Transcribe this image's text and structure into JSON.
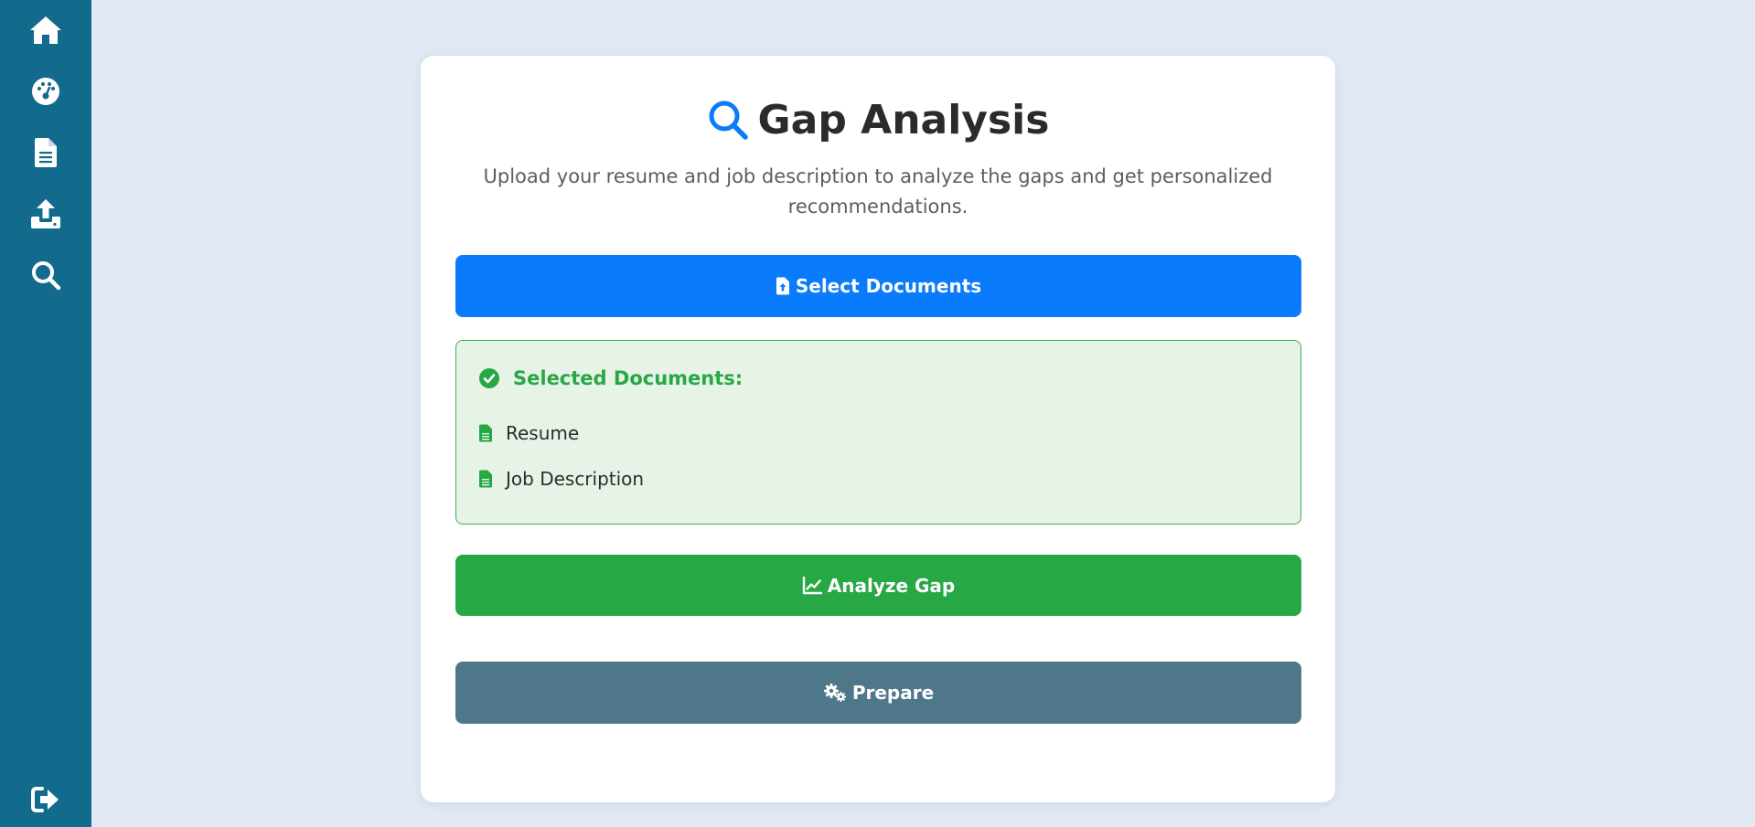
{
  "sidebar": {
    "items": [
      {
        "name": "home",
        "icon": "home-icon"
      },
      {
        "name": "dashboard",
        "icon": "gauge-icon"
      },
      {
        "name": "documents",
        "icon": "file-icon"
      },
      {
        "name": "upload",
        "icon": "upload-icon"
      },
      {
        "name": "search",
        "icon": "search-icon"
      }
    ],
    "logout_icon": "sign-out-icon"
  },
  "page": {
    "title": "Gap Analysis",
    "title_icon": "search-icon",
    "subtitle": "Upload your resume and job description to analyze the gaps and get personalized recommendations."
  },
  "buttons": {
    "select_documents": "Select Documents",
    "analyze_gap": "Analyze Gap",
    "prepare": "Prepare"
  },
  "selected_documents": {
    "title": "Selected Documents:",
    "items": [
      "Resume",
      "Job Description"
    ]
  },
  "colors": {
    "sidebar": "#126a8c",
    "background": "#dfe8f3",
    "primary": "#0a7bfa",
    "success": "#28a745",
    "secondary": "#4e7789"
  }
}
